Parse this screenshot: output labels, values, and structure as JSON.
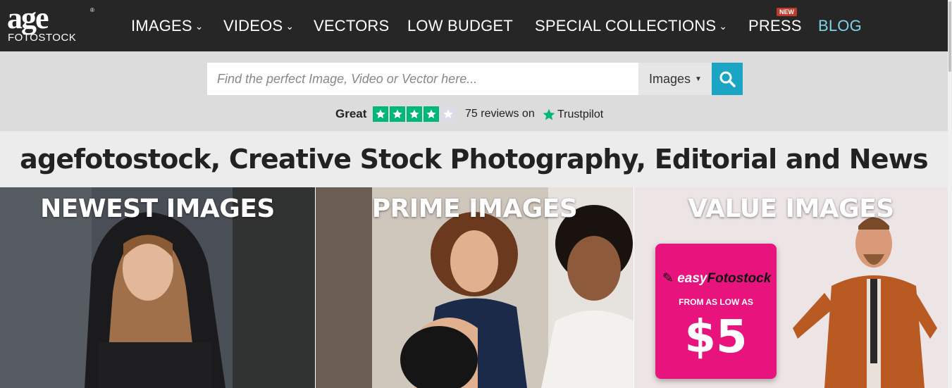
{
  "logo": {
    "age": "age",
    "fotostock": "FOTOSTOCK",
    "reg": "®"
  },
  "nav": {
    "images": "IMAGES",
    "videos": "VIDEOS",
    "vectors": "VECTORS",
    "low_budget": "LOW BUDGET",
    "special_collections": "SPECIAL COLLECTIONS",
    "press": "PRESS",
    "press_badge": "NEW",
    "blog": "BLOG"
  },
  "search": {
    "placeholder": "Find the perfect Image, Video or Vector here...",
    "type_selected": "Images"
  },
  "trustpilot": {
    "rating_word": "Great",
    "stars_filled": 4,
    "stars_total": 5,
    "reviews_text": "75 reviews on",
    "brand": "Trustpilot"
  },
  "page_title": "agefotostock, Creative Stock Photography, Editorial and News",
  "panels": [
    {
      "title": "NEWEST IMAGES"
    },
    {
      "title": "PRIME IMAGES"
    },
    {
      "title": "VALUE IMAGES"
    }
  ],
  "promo": {
    "brand_part1": "easy",
    "brand_part2": "Fotostock",
    "from_text": "FROM AS LOW AS",
    "price": "$5"
  },
  "colors": {
    "topbar": "#262626",
    "accent": "#1aa5c4",
    "trustpilot_green": "#00b67a",
    "promo_pink": "#e8137d",
    "blog_link": "#7fd3e6"
  }
}
